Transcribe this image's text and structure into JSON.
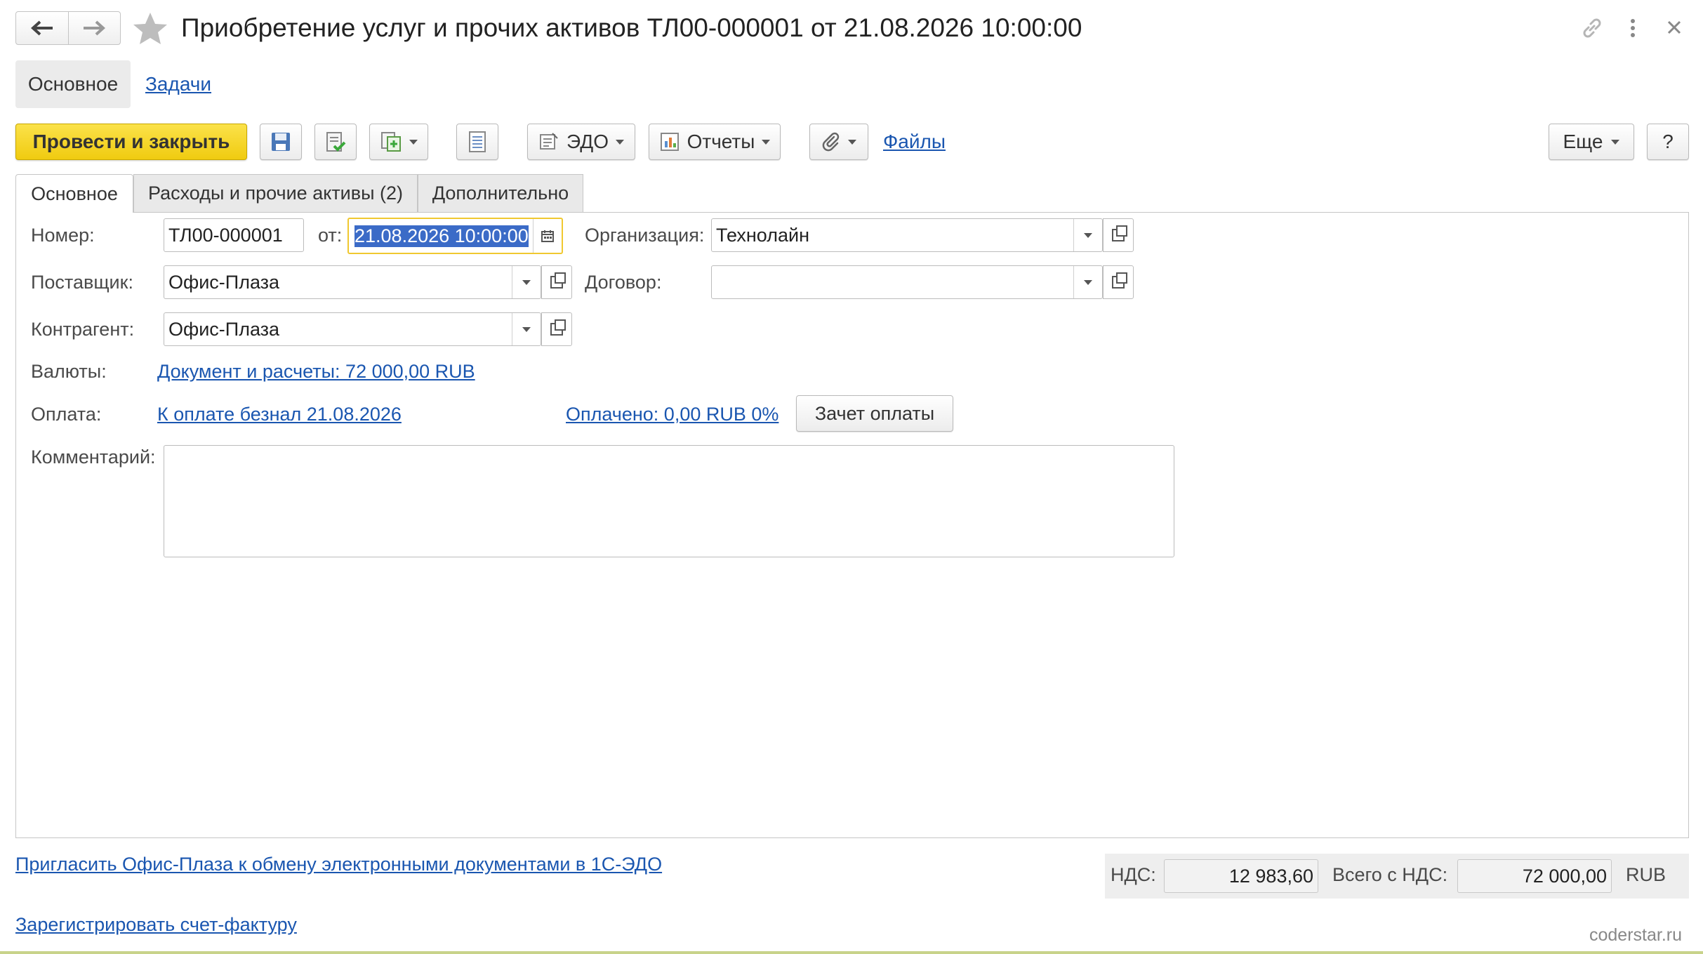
{
  "header": {
    "title": "Приобретение услуг и прочих активов ТЛ00-000001 от 21.08.2026 10:00:00"
  },
  "nav_tabs": [
    {
      "label": "Основное"
    },
    {
      "label": "Задачи"
    }
  ],
  "toolbar": {
    "post_close_label": "Провести и закрыть",
    "edo_label": "ЭДО",
    "reports_label": "Отчеты",
    "files_label": "Файлы",
    "more_label": "Еще",
    "help_label": "?"
  },
  "form_tabs": [
    {
      "label": "Основное"
    },
    {
      "label": "Расходы и прочие активы (2)"
    },
    {
      "label": "Дополнительно"
    }
  ],
  "form": {
    "number_label": "Номер:",
    "number_value": "ТЛ00-000001",
    "date_label": "от:",
    "date_value": "21.08.2026 10:00:00",
    "org_label": "Организация:",
    "org_value": "Технолайн",
    "supplier_label": "Поставщик:",
    "supplier_value": "Офис-Плаза",
    "contract_label": "Договор:",
    "contract_value": "",
    "counterparty_label": "Контрагент:",
    "counterparty_value": "Офис-Плаза",
    "currency_label": "Валюты:",
    "currency_link": "Документ и расчеты: 72 000,00 RUB",
    "payment_label": "Оплата:",
    "payment_link": "К оплате безнал 21.08.2026",
    "paid_link": "Оплачено: 0,00 RUB 0%",
    "offset_button": "Зачет оплаты",
    "comment_label": "Комментарий:",
    "comment_value": ""
  },
  "footer": {
    "invite_link": "Пригласить Офис-Плаза к обмену электронными документами в 1С-ЭДО",
    "register_link": "Зарегистрировать счет-фактуру",
    "vat_label": "НДС:",
    "vat_value": "12 983,60",
    "total_label": "Всего с НДС:",
    "total_value": "72 000,00",
    "currency": "RUB",
    "watermark": "coderstar.ru"
  },
  "colors": {
    "primary_button": "#f5d423",
    "link": "#1a56b0",
    "selection": "#3b6bc7"
  },
  "icons": [
    "back-arrow-icon",
    "forward-arrow-icon",
    "star-icon",
    "link-icon",
    "kebab-menu-icon",
    "close-icon",
    "save-icon",
    "post-icon",
    "create-based-on-icon",
    "document-icon",
    "edo-icon",
    "reports-icon",
    "paperclip-icon",
    "calendar-icon",
    "chevron-down-icon",
    "open-form-icon"
  ]
}
